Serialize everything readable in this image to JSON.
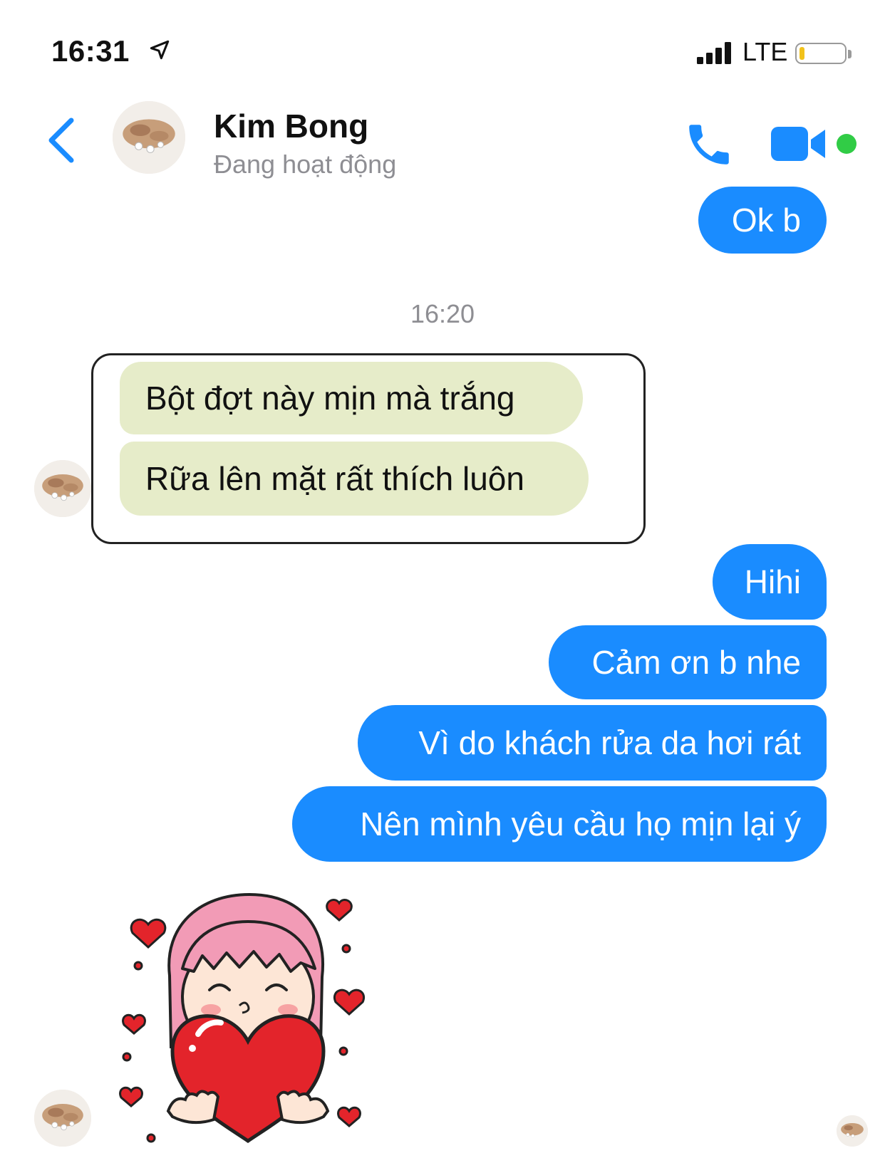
{
  "status_bar": {
    "time": "16:31",
    "network": "LTE",
    "battery_level": 0.12,
    "battery_color": "#f2c21b",
    "location_icon": "location-arrow-icon",
    "signal_icon": "cellular-signal-icon"
  },
  "header": {
    "contact_name": "Kim Bong",
    "contact_status": "Đang hoạt động",
    "accent_color": "#1a8cff",
    "active_color": "#31cc46",
    "icons": [
      "chevron-left-icon",
      "phone-icon",
      "video-camera-icon"
    ]
  },
  "conversation": {
    "timestamp": "16:20",
    "messages": [
      {
        "from": "me",
        "text": "Ok b"
      },
      {
        "from": "contact",
        "text": "Bột đợt này mịn mà trắng"
      },
      {
        "from": "contact",
        "text": "Rữa lên mặt rất thích luôn"
      },
      {
        "from": "me",
        "text": "Hihi"
      },
      {
        "from": "me",
        "text": "Cảm ơn b nhe"
      },
      {
        "from": "me",
        "text": "Vì do khách rửa da hơi rát"
      },
      {
        "from": "me",
        "text": "Nên mình yêu cầu họ mịn lại ý"
      }
    ],
    "sticker": "girl-holding-heart-sticker",
    "outgoing_color": "#1a8cff",
    "incoming_highlight_color": "#e6ecc9"
  }
}
